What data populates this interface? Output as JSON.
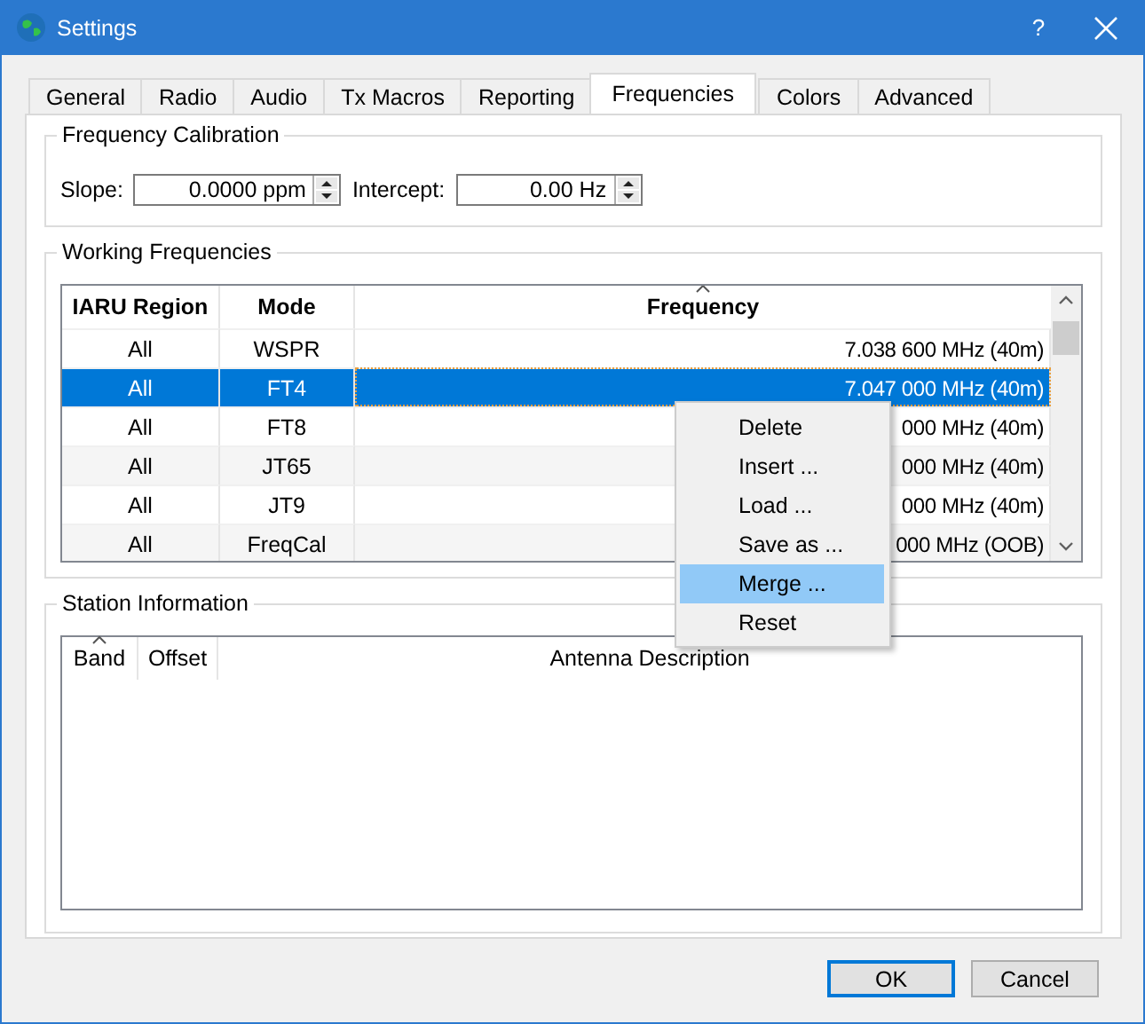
{
  "window": {
    "title": "Settings",
    "help": "?"
  },
  "tabs": [
    {
      "label": "General",
      "selected": false
    },
    {
      "label": "Radio",
      "selected": false
    },
    {
      "label": "Audio",
      "selected": false
    },
    {
      "label": "Tx Macros",
      "selected": false
    },
    {
      "label": "Reporting",
      "selected": false
    },
    {
      "label": "Frequencies",
      "selected": true
    },
    {
      "label": "Colors",
      "selected": false
    },
    {
      "label": "Advanced",
      "selected": false
    }
  ],
  "frequency_calibration": {
    "title": "Frequency Calibration",
    "fields": [
      {
        "label": "Slope:",
        "value": "0.0000 ppm"
      },
      {
        "label": "Intercept:",
        "value": "0.00 Hz"
      }
    ]
  },
  "working_frequencies": {
    "title": "Working Frequencies",
    "columns": [
      "IARU Region",
      "Mode",
      "Frequency"
    ],
    "rows": [
      {
        "cells": [
          "All",
          "WSPR",
          "7.038 600 MHz (40m)"
        ],
        "selected": false
      },
      {
        "cells": [
          "All",
          "FT4",
          "7.047 000 MHz (40m)"
        ],
        "selected": true
      },
      {
        "cells": [
          "All",
          "FT8",
          "000 MHz (40m)"
        ],
        "selected": false
      },
      {
        "cells": [
          "All",
          "JT65",
          "000 MHz (40m)"
        ],
        "selected": false
      },
      {
        "cells": [
          "All",
          "JT9",
          "000 MHz (40m)"
        ],
        "selected": false
      },
      {
        "cells": [
          "All",
          "FreqCal",
          "000 MHz (OOB)"
        ],
        "selected": false
      }
    ]
  },
  "station_information": {
    "title": "Station Information",
    "columns": [
      "Band",
      "Offset",
      "Antenna Description"
    ]
  },
  "context_menu": {
    "items": [
      {
        "label": "Delete",
        "selected": false
      },
      {
        "label": "Insert ...",
        "selected": false
      },
      {
        "label": "Load ...",
        "selected": false
      },
      {
        "label": "Save as ...",
        "selected": false
      },
      {
        "label": "Merge ...",
        "selected": true
      },
      {
        "label": "Reset",
        "selected": false
      }
    ]
  },
  "buttons": [
    {
      "label": "OK",
      "default": true
    },
    {
      "label": "Cancel",
      "default": false
    }
  ]
}
